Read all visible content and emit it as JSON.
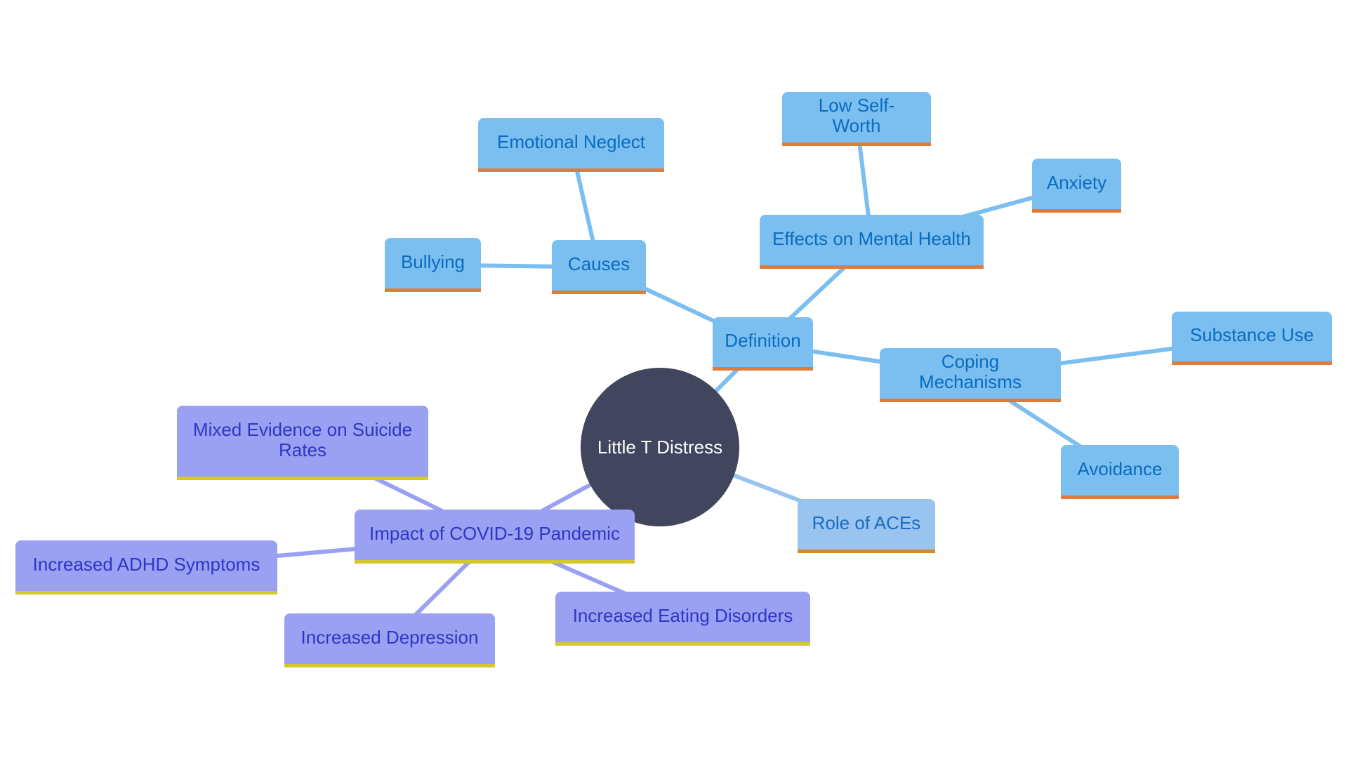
{
  "diagram": {
    "type": "mind-map",
    "root": {
      "id": "root",
      "label": "Little T Distress"
    },
    "colors": {
      "root_fill": "#41465e",
      "root_text": "#ffffff",
      "blue_fill": "#7bbff0",
      "blue_text": "#0a6bbf",
      "blue_underline": "#e07b39",
      "lightblue_fill": "#9ac4f0",
      "lightblue_text": "#1a6cc4",
      "purple_fill": "#9aa0f2",
      "purple_text": "#2f36c4",
      "purple_underline": "#d4c82a",
      "blue_edge": "#7bbff0",
      "lightblue_edge": "#9ac4f0",
      "purple_edge": "#9aa0f2"
    },
    "nodes": [
      {
        "id": "definition",
        "label": "Definition",
        "parent": "root",
        "theme": "blue"
      },
      {
        "id": "causes",
        "label": "Causes",
        "parent": "definition",
        "theme": "blue"
      },
      {
        "id": "emotional-neglect",
        "label": "Emotional Neglect",
        "parent": "causes",
        "theme": "blue"
      },
      {
        "id": "bullying",
        "label": "Bullying",
        "parent": "causes",
        "theme": "blue"
      },
      {
        "id": "effects",
        "label": "Effects on Mental Health",
        "parent": "definition",
        "theme": "blue"
      },
      {
        "id": "low-self-worth",
        "label": "Low Self-Worth",
        "parent": "effects",
        "theme": "blue"
      },
      {
        "id": "anxiety",
        "label": "Anxiety",
        "parent": "effects",
        "theme": "blue"
      },
      {
        "id": "coping",
        "label": "Coping Mechanisms",
        "parent": "definition",
        "theme": "blue"
      },
      {
        "id": "substance-use",
        "label": "Substance Use",
        "parent": "coping",
        "theme": "blue"
      },
      {
        "id": "avoidance",
        "label": "Avoidance",
        "parent": "coping",
        "theme": "blue"
      },
      {
        "id": "role-aces",
        "label": "Role of ACEs",
        "parent": "root",
        "theme": "lightblue"
      },
      {
        "id": "covid",
        "label": "Impact of COVID-19 Pandemic",
        "parent": "root",
        "theme": "purple"
      },
      {
        "id": "suicide",
        "label": "Mixed Evidence on Suicide Rates",
        "parent": "covid",
        "theme": "purple"
      },
      {
        "id": "adhd",
        "label": "Increased ADHD Symptoms",
        "parent": "covid",
        "theme": "purple"
      },
      {
        "id": "depression",
        "label": "Increased Depression",
        "parent": "covid",
        "theme": "purple"
      },
      {
        "id": "eating",
        "label": "Increased Eating Disorders",
        "parent": "covid",
        "theme": "purple"
      }
    ]
  }
}
